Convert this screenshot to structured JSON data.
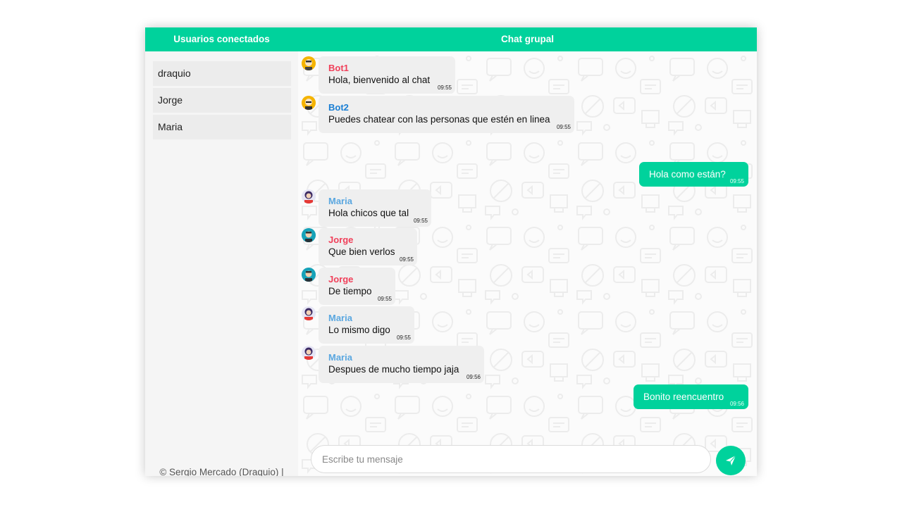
{
  "header": {
    "users_title": "Usuarios conectados",
    "chat_title": "Chat grupal"
  },
  "sidebar": {
    "users": [
      "draquio",
      "Jorge",
      "Maria"
    ],
    "credit": "© Sergio Mercado (Draquio) | Fullstack Developer"
  },
  "messages": [
    {
      "from": "Bot1",
      "text": "Hola, bienvenido al chat",
      "time": "09:55",
      "own": false,
      "name_color": "#f0405a",
      "avatar": "bot1-avatar-icon"
    },
    {
      "from": "Bot2",
      "text": "Puedes chatear con las personas que estén en linea",
      "time": "09:55",
      "own": false,
      "name_color": "#1a7fd4",
      "avatar": "bot2-avatar-icon"
    },
    {
      "from": "draquio",
      "text": "Hola como están?",
      "time": "09:55",
      "own": true
    },
    {
      "from": "Maria",
      "text": "Hola chicos que tal",
      "time": "09:55",
      "own": false,
      "name_color": "#5aa7e0",
      "avatar": "maria-avatar-icon"
    },
    {
      "from": "Jorge",
      "text": "Que bien verlos",
      "time": "09:55",
      "own": false,
      "name_color": "#f0405a",
      "avatar": "jorge-avatar-icon"
    },
    {
      "from": "Jorge",
      "text": "De tiempo",
      "time": "09:55",
      "own": false,
      "name_color": "#f0405a",
      "avatar": "jorge-avatar-icon"
    },
    {
      "from": "Maria",
      "text": "Lo mismo digo",
      "time": "09:55",
      "own": false,
      "name_color": "#5aa7e0",
      "avatar": "maria-avatar-icon"
    },
    {
      "from": "Maria",
      "text": "Despues de mucho tiempo jaja",
      "time": "09:56",
      "own": false,
      "name_color": "#5aa7e0",
      "avatar": "maria-avatar-icon"
    },
    {
      "from": "draquio",
      "text": "Bonito reencuentro",
      "time": "09:56",
      "own": true
    }
  ],
  "composer": {
    "placeholder": "Escribe tu mensaje",
    "value": "",
    "send_icon": "send-icon"
  },
  "colors": {
    "accent": "#00d29c",
    "bubble": "#efefef",
    "sidebar": "#f5f5f5"
  }
}
